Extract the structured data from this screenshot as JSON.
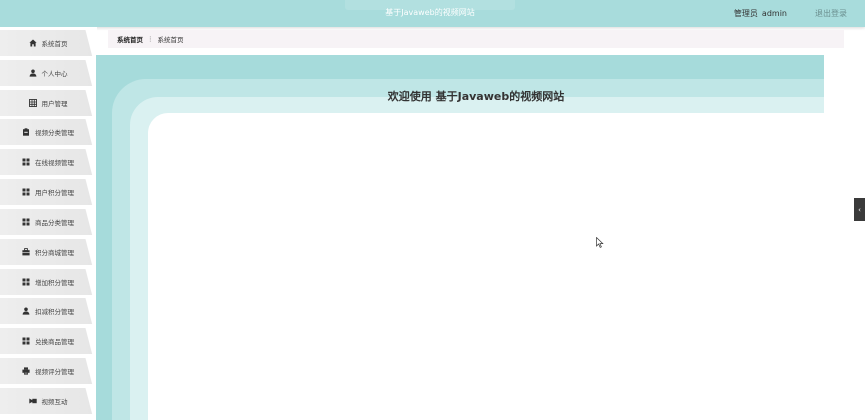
{
  "header": {
    "title": "基于Javaweb的视频网站",
    "user_role": "管理员",
    "user_name": "admin",
    "logout": "退出登录"
  },
  "sidebar": {
    "items": [
      {
        "label": "系统首页",
        "icon": "home-icon"
      },
      {
        "label": "个人中心",
        "icon": "user-icon"
      },
      {
        "label": "用户管理",
        "icon": "grid-icon"
      },
      {
        "label": "视频分类管理",
        "icon": "clipboard-icon"
      },
      {
        "label": "在线视频管理",
        "icon": "apps-icon"
      },
      {
        "label": "用户积分管理",
        "icon": "apps-icon"
      },
      {
        "label": "商品分类管理",
        "icon": "apps-icon"
      },
      {
        "label": "积分商城管理",
        "icon": "briefcase-icon"
      },
      {
        "label": "增加积分管理",
        "icon": "apps-icon"
      },
      {
        "label": "扣减积分管理",
        "icon": "user-icon"
      },
      {
        "label": "兑换商品管理",
        "icon": "apps-icon"
      },
      {
        "label": "视频评分管理",
        "icon": "printer-icon"
      },
      {
        "label": "视频互动",
        "icon": "video-icon"
      }
    ]
  },
  "breadcrumb": {
    "root": "系统首页",
    "separator": "⋮",
    "current": "系统首页"
  },
  "main": {
    "welcome": "欢迎使用 基于Javaweb的视频网站"
  },
  "colors": {
    "header_bg": "#a8dcdc",
    "main_teal": "#a6dbdb",
    "band_light": "#bfe6e6",
    "band_lighter": "#daf1f1"
  }
}
